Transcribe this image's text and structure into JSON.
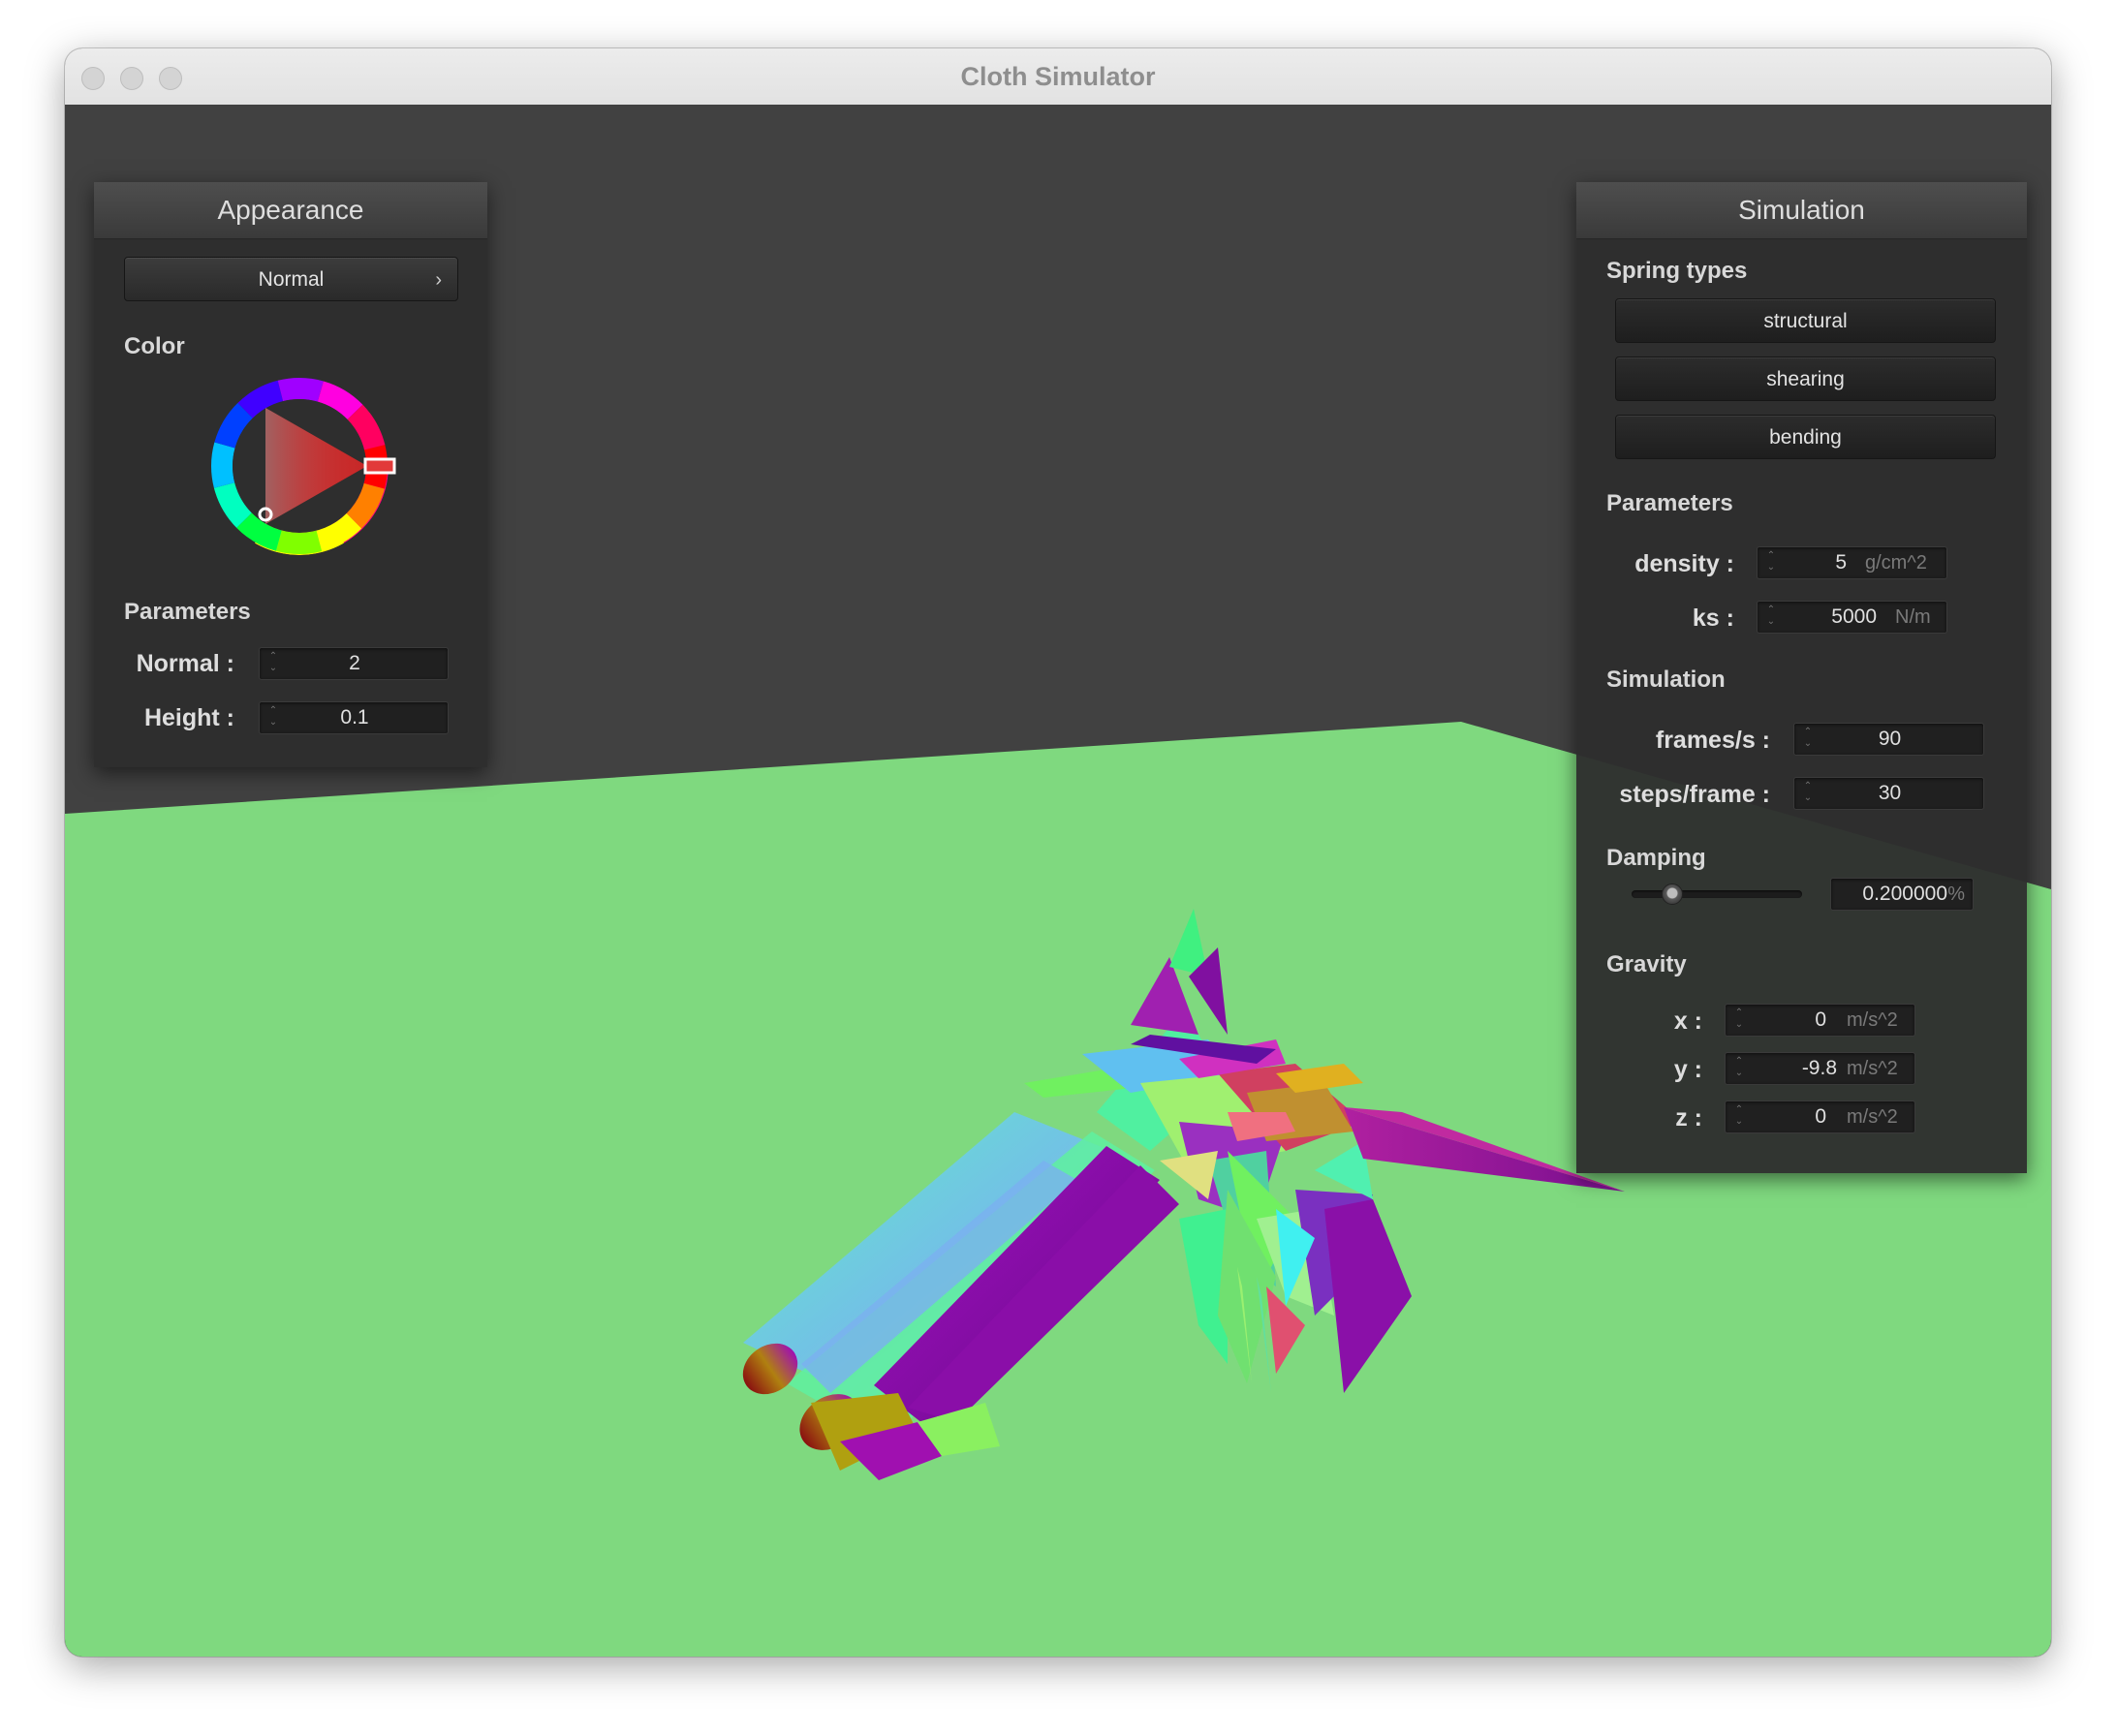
{
  "window": {
    "title": "Cloth Simulator"
  },
  "appearance": {
    "header": "Appearance",
    "shader_dropdown": {
      "value": "Normal",
      "chevron": "›"
    },
    "color_label": "Color",
    "color_selected": "#e23a3a",
    "parameters_label": "Parameters",
    "normal": {
      "label": "Normal :",
      "value": "2"
    },
    "height": {
      "label": "Height :",
      "value": "0.1"
    }
  },
  "simulation": {
    "header": "Simulation",
    "spring_types_label": "Spring types",
    "spring_buttons": {
      "structural": "structural",
      "shearing": "shearing",
      "bending": "bending"
    },
    "parameters_label": "Parameters",
    "density": {
      "label": "density :",
      "value": "5",
      "unit": "g/cm^2"
    },
    "ks": {
      "label": "ks :",
      "value": "5000",
      "unit": "N/m"
    },
    "simulation_label": "Simulation",
    "frames_per_sec": {
      "label": "frames/s :",
      "value": "90"
    },
    "steps_per_frame": {
      "label": "steps/frame :",
      "value": "30"
    },
    "damping_label": "Damping",
    "damping": {
      "value": "0.200000",
      "unit": "%",
      "slider_fraction": 0.2
    },
    "gravity_label": "Gravity",
    "gravity_x": {
      "label": "x :",
      "value": "0",
      "unit": "m/s^2"
    },
    "gravity_y": {
      "label": "y :",
      "value": "-9.8",
      "unit": "m/s^2"
    },
    "gravity_z": {
      "label": "z :",
      "value": "0",
      "unit": "m/s^2"
    }
  },
  "scene": {
    "plane_color": "#7fd97f",
    "background_color": "#414141"
  }
}
